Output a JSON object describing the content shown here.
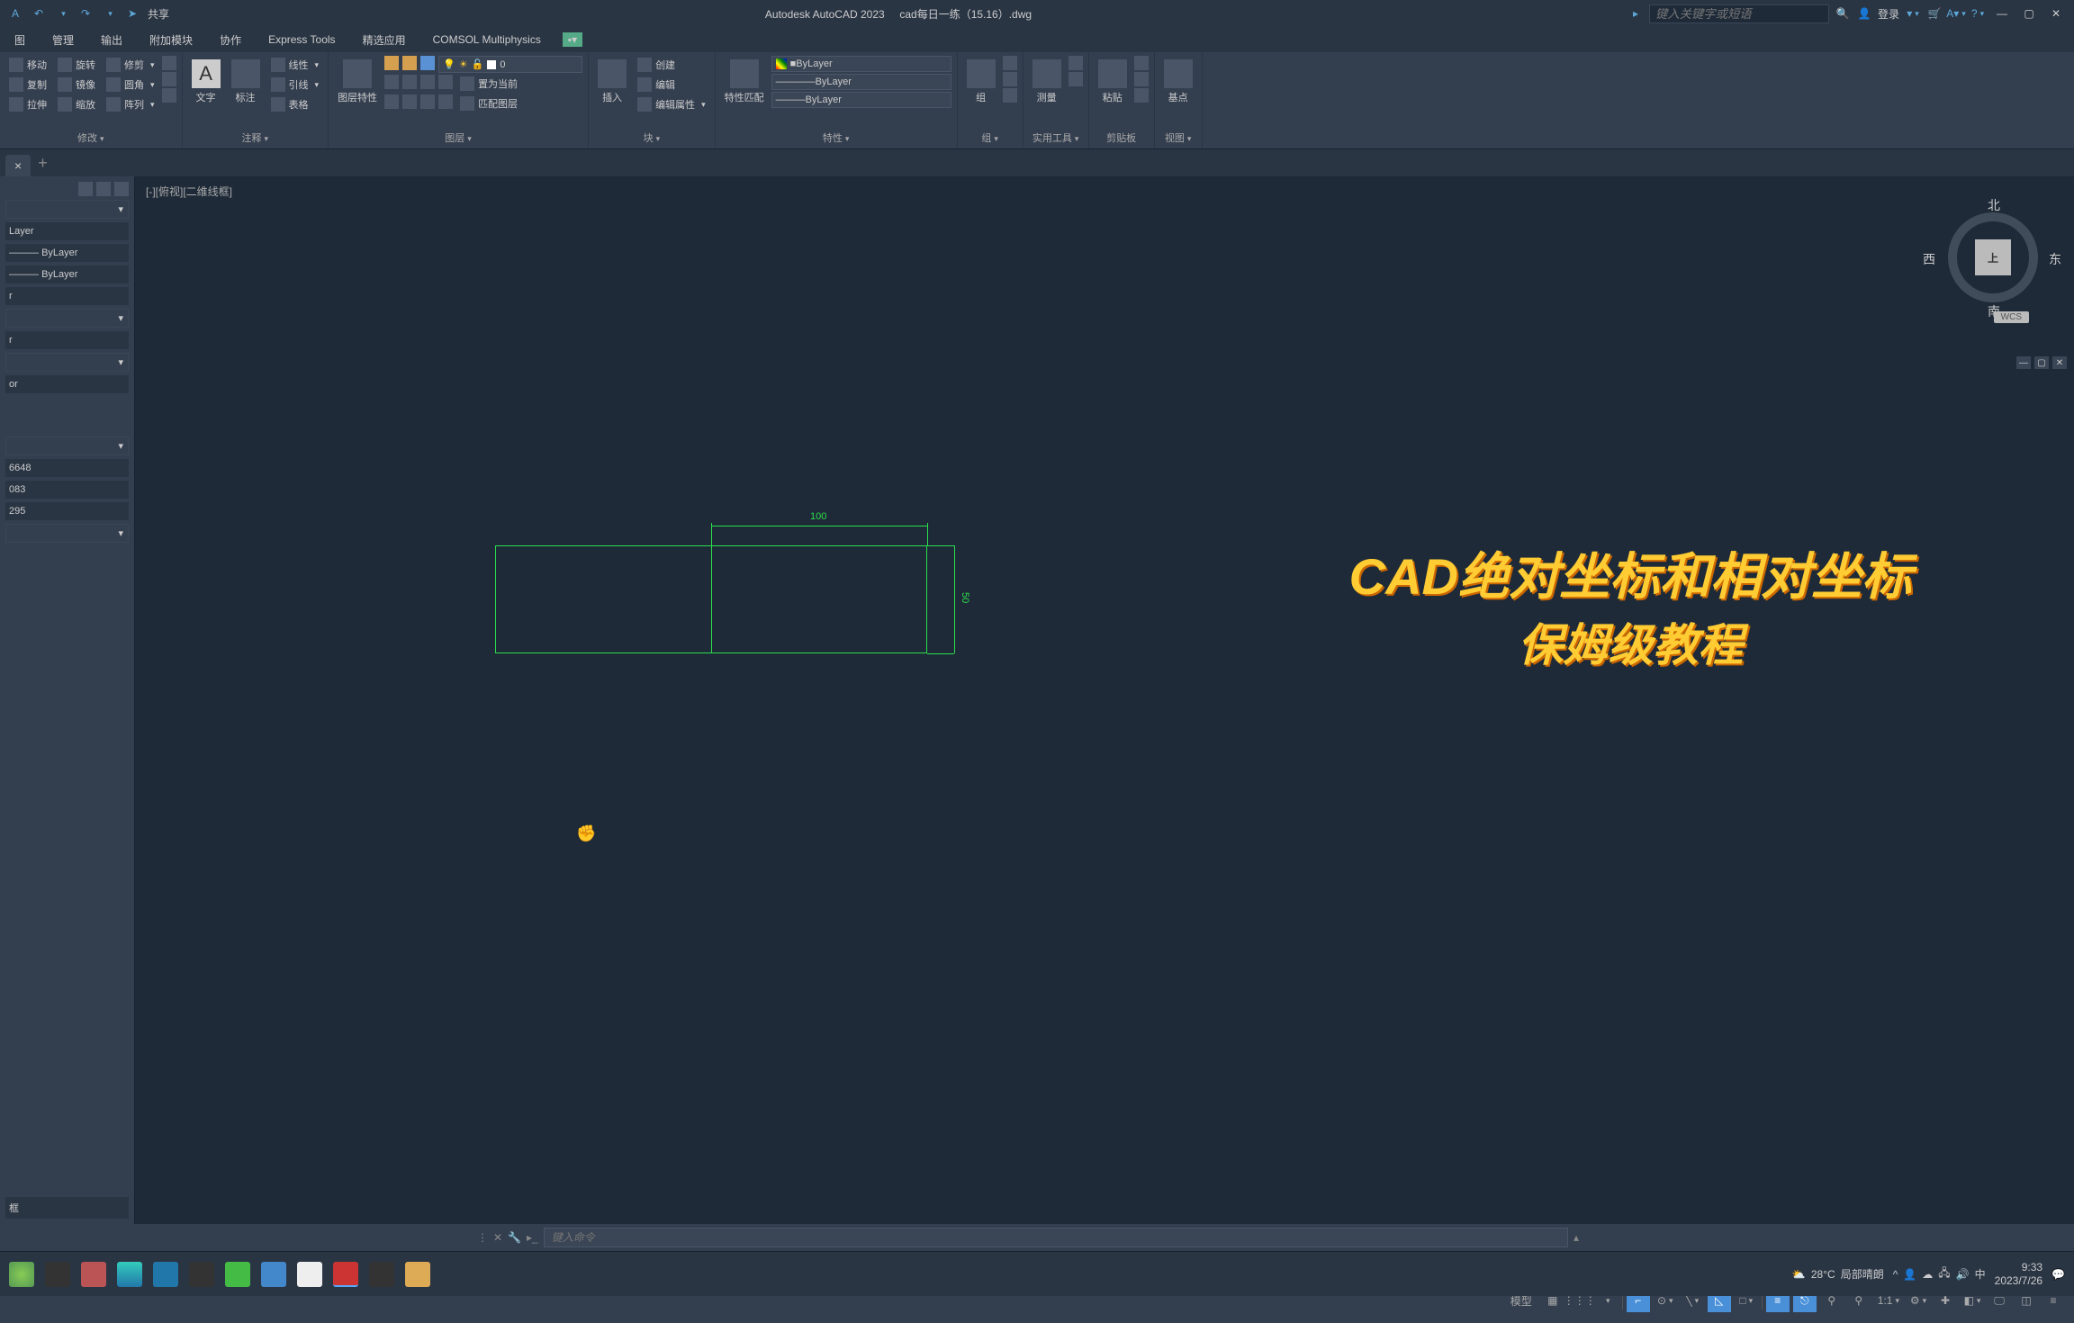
{
  "app": {
    "name": "Autodesk AutoCAD 2023",
    "document": "cad每日一练（15.16）.dwg",
    "share": "共享",
    "search_placeholder": "键入关键字或短语",
    "login": "登录"
  },
  "menu": {
    "items": [
      "图",
      "管理",
      "输出",
      "附加模块",
      "协作",
      "Express Tools",
      "精选应用",
      "COMSOL Multiphysics"
    ]
  },
  "ribbon": {
    "modify": {
      "title": "修改",
      "move": "移动",
      "rotate": "旋转",
      "trim": "修剪",
      "copy": "复制",
      "mirror": "镜像",
      "fillet": "圆角",
      "stretch": "拉伸",
      "scale": "缩放",
      "array": "阵列"
    },
    "annotate": {
      "title": "注释",
      "text": "文字",
      "dim": "标注",
      "line": "线性",
      "leader": "引线",
      "table": "表格"
    },
    "layer": {
      "title": "图层",
      "props": "图层特性",
      "lock": "锁定",
      "make_current": "置为当前",
      "match": "匹配图层",
      "current": "0"
    },
    "block": {
      "title": "块",
      "insert": "插入",
      "create": "创建",
      "edit": "编辑",
      "edit_attr": "编辑属性"
    },
    "props": {
      "title": "特性",
      "match": "特性匹配",
      "bylayer": "ByLayer"
    },
    "group": {
      "title": "组",
      "label": "组"
    },
    "util": {
      "title": "实用工具",
      "measure": "测量"
    },
    "clip": {
      "title": "剪贴板",
      "paste": "粘贴"
    },
    "view": {
      "title": "视图",
      "basis": "基点"
    }
  },
  "left_panel": {
    "layer": "Layer",
    "bylayer": "ByLayer",
    "vals": [
      "6648",
      "083",
      "295"
    ]
  },
  "canvas": {
    "view_label": "[-][俯视][二维线框]",
    "dim_h": "100",
    "dim_v": "50",
    "cube": {
      "n": "北",
      "s": "南",
      "e": "东",
      "w": "西",
      "top": "上"
    },
    "wcs": "WCS",
    "overlay_l1": "CAD绝对坐标和相对坐标",
    "overlay_l2": "保姆级教程"
  },
  "cmd": {
    "placeholder": "键入命令"
  },
  "status": {
    "model": "模型",
    "scale": "1:1"
  },
  "taskbar": {
    "weather_temp": "28°C",
    "weather_desc": "局部晴朗",
    "ime": "中",
    "time": "9:33",
    "date": "2023/7/26"
  }
}
